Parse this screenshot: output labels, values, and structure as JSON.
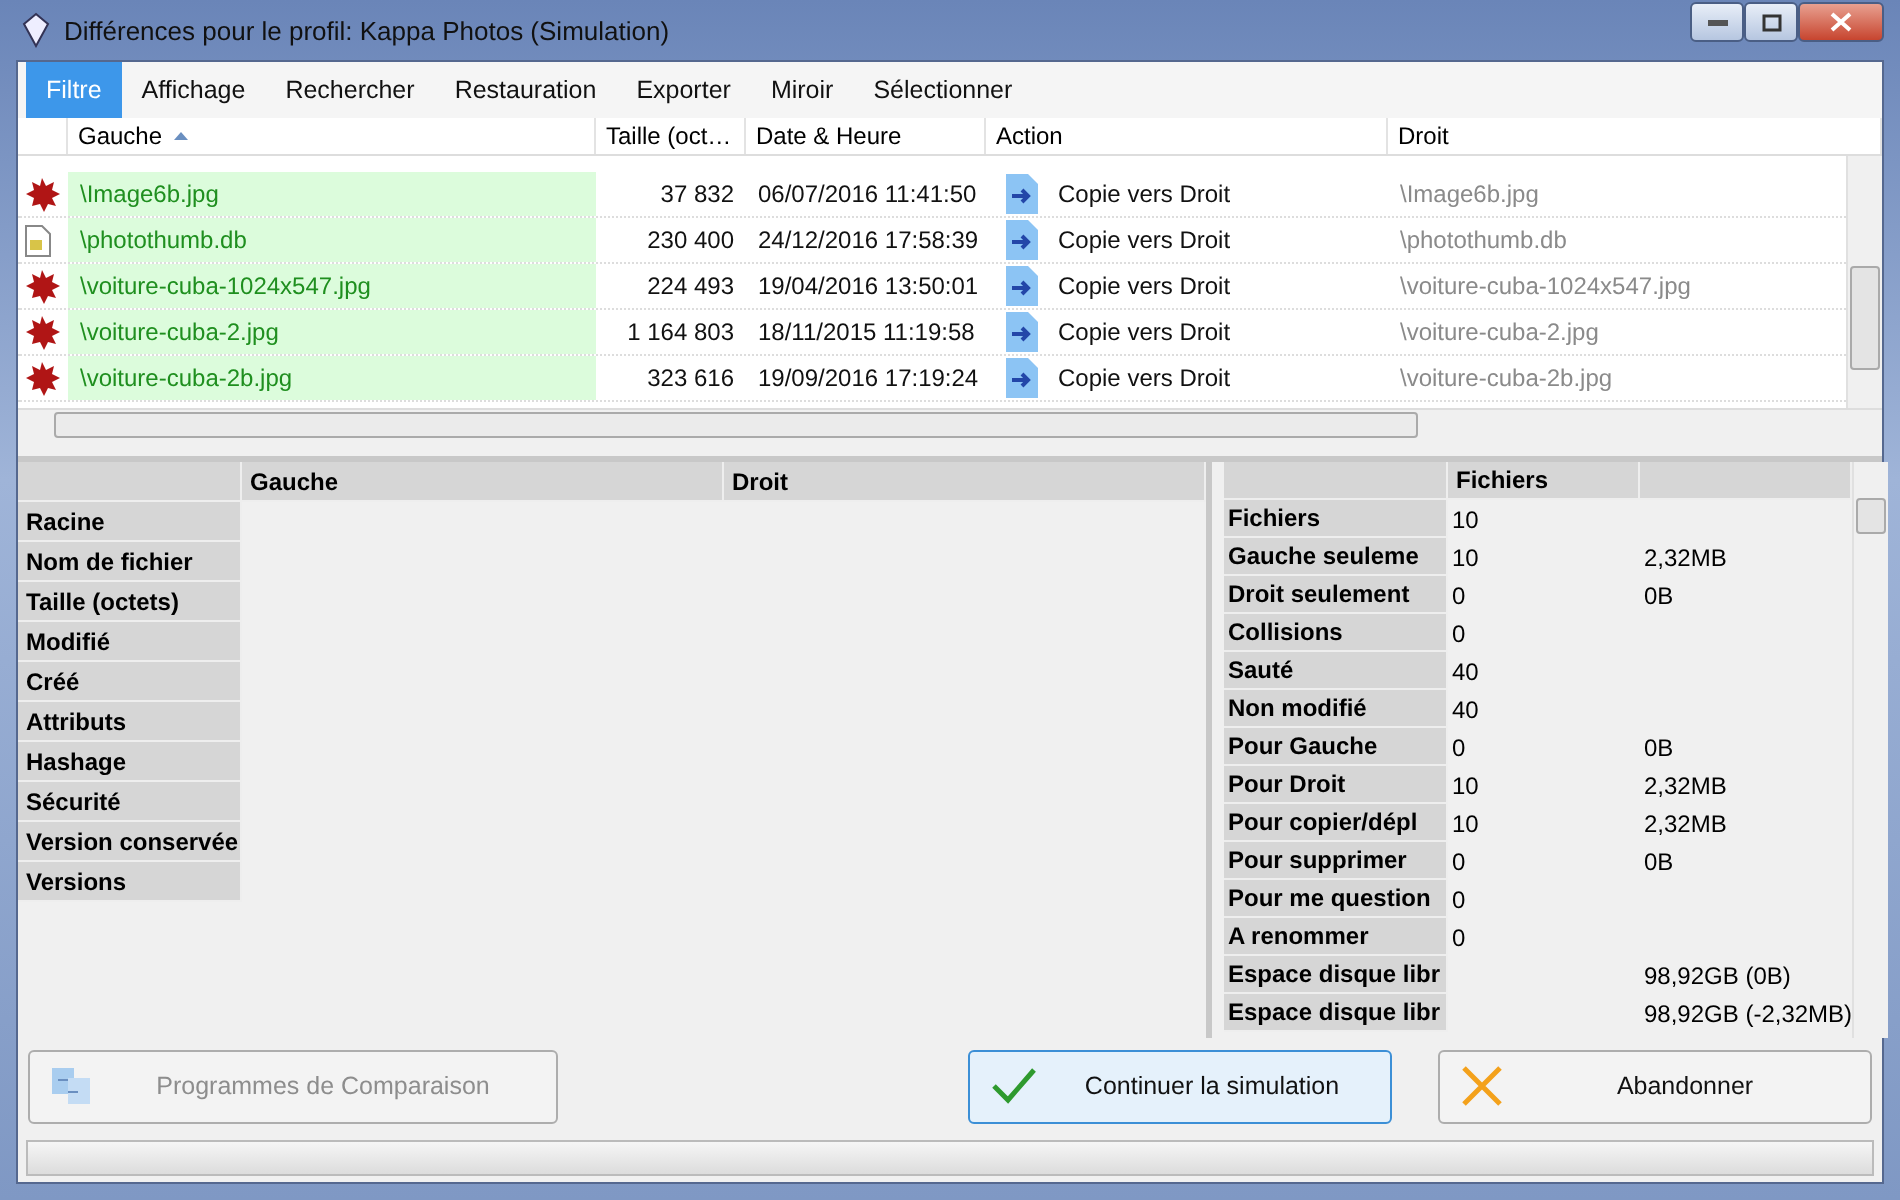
{
  "window": {
    "title": "Différences pour le profil: Kappa Photos (Simulation)"
  },
  "menu": [
    {
      "label": "Filtre",
      "selected": true
    },
    {
      "label": "Affichage",
      "selected": false
    },
    {
      "label": "Rechercher",
      "selected": false
    },
    {
      "label": "Restauration",
      "selected": false
    },
    {
      "label": "Exporter",
      "selected": false
    },
    {
      "label": "Miroir",
      "selected": false
    },
    {
      "label": "Sélectionner",
      "selected": false
    }
  ],
  "file_table": {
    "columns": [
      "Gauche",
      "Taille (oct…",
      "Date & Heure",
      "Action",
      "Droit"
    ],
    "rows": [
      {
        "kind": "image",
        "left": "\\Image6b.jpg",
        "size": "37 832",
        "date": "06/07/2016 11:41:50",
        "action": "Copie vers Droit",
        "right": "\\Image6b.jpg"
      },
      {
        "kind": "file",
        "left": "\\photothumb.db",
        "size": "230 400",
        "date": "24/12/2016 17:58:39",
        "action": "Copie vers Droit",
        "right": "\\photothumb.db"
      },
      {
        "kind": "image",
        "left": "\\voiture-cuba-1024x547.jpg",
        "size": "224 493",
        "date": "19/04/2016 13:50:01",
        "action": "Copie vers Droit",
        "right": "\\voiture-cuba-1024x547.jpg"
      },
      {
        "kind": "image",
        "left": "\\voiture-cuba-2.jpg",
        "size": "1 164 803",
        "date": "18/11/2015 11:19:58",
        "action": "Copie vers Droit",
        "right": "\\voiture-cuba-2.jpg"
      },
      {
        "kind": "image",
        "left": "\\voiture-cuba-2b.jpg",
        "size": "323 616",
        "date": "19/09/2016 17:19:24",
        "action": "Copie vers Droit",
        "right": "\\voiture-cuba-2b.jpg"
      }
    ]
  },
  "details": {
    "columns": [
      "Gauche",
      "Droit"
    ],
    "rows": [
      "Racine",
      "Nom de fichier",
      "Taille (octets)",
      "Modifié",
      "Créé",
      "Attributs",
      "Hashage",
      "Sécurité",
      "Version conservée",
      "Versions"
    ]
  },
  "stats": {
    "column": "Fichiers",
    "rows": [
      {
        "label": "Fichiers",
        "count": "10",
        "size": ""
      },
      {
        "label": "Gauche seuleme",
        "count": "10",
        "size": "2,32MB"
      },
      {
        "label": "Droit seulement",
        "count": "0",
        "size": "0B"
      },
      {
        "label": "Collisions",
        "count": "0",
        "size": ""
      },
      {
        "label": "Sauté",
        "count": "40",
        "size": ""
      },
      {
        "label": "Non modifié",
        "count": "40",
        "size": ""
      },
      {
        "label": "Pour Gauche",
        "count": "0",
        "size": "0B"
      },
      {
        "label": "Pour Droit",
        "count": "10",
        "size": "2,32MB"
      },
      {
        "label": "Pour copier/dépl",
        "count": "10",
        "size": "2,32MB"
      },
      {
        "label": "Pour supprimer",
        "count": "0",
        "size": "0B"
      },
      {
        "label": "Pour me question",
        "count": "0",
        "size": ""
      },
      {
        "label": "A renommer",
        "count": "0",
        "size": ""
      },
      {
        "label": "Espace disque libr",
        "count": "",
        "size": "98,92GB (0B)"
      },
      {
        "label": "Espace disque libr",
        "count": "",
        "size": "98,92GB (-2,32MB)"
      }
    ]
  },
  "buttons": [
    {
      "kind": "compare",
      "label": "Programmes de Comparaison",
      "disabled": true,
      "default": false
    },
    {
      "kind": "continue",
      "label": "Continuer la simulation",
      "disabled": false,
      "default": true
    },
    {
      "kind": "abort",
      "label": "Abandonner",
      "disabled": false,
      "default": false
    }
  ]
}
